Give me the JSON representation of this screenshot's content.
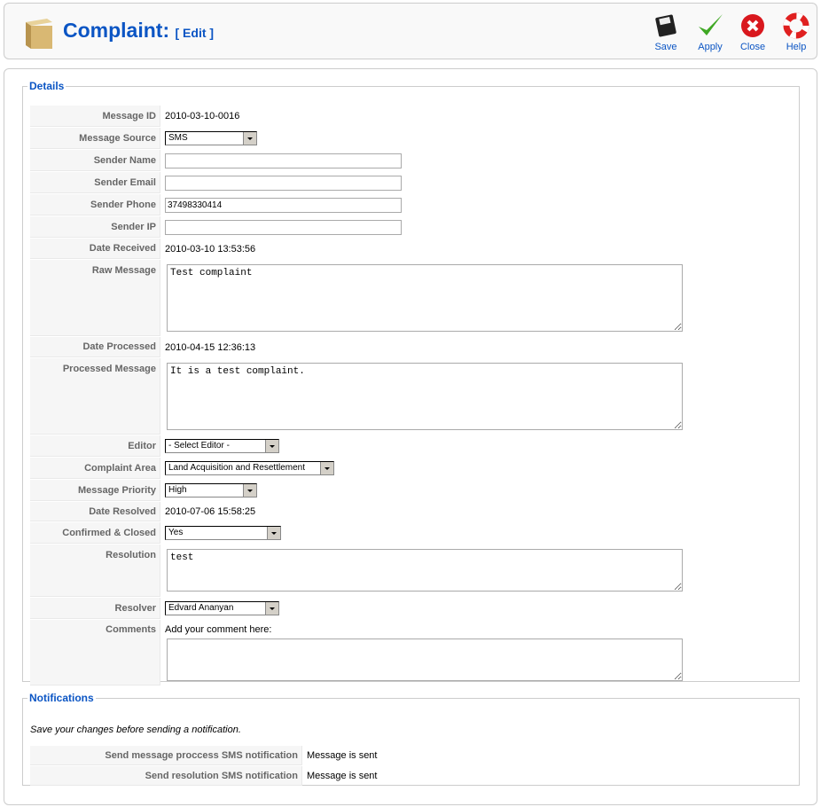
{
  "header": {
    "title": "Complaint:",
    "subtitle": "[ Edit ]",
    "icon": "package-box-icon",
    "toolbar": [
      {
        "label": "Save",
        "icon": "floppy-disk-icon"
      },
      {
        "label": "Apply",
        "icon": "checkmark-icon"
      },
      {
        "label": "Close",
        "icon": "close-circle-icon"
      },
      {
        "label": "Help",
        "icon": "lifebuoy-icon"
      }
    ]
  },
  "details": {
    "legend": "Details",
    "message_id": {
      "label": "Message ID",
      "value": "2010-03-10-0016"
    },
    "message_source": {
      "label": "Message Source",
      "value": "SMS"
    },
    "sender_name": {
      "label": "Sender Name",
      "value": ""
    },
    "sender_email": {
      "label": "Sender Email",
      "value": ""
    },
    "sender_phone": {
      "label": "Sender Phone",
      "value": "37498330414"
    },
    "sender_ip": {
      "label": "Sender IP",
      "value": ""
    },
    "date_received": {
      "label": "Date Received",
      "value": "2010-03-10 13:53:56"
    },
    "raw_message": {
      "label": "Raw Message",
      "value": "Test complaint"
    },
    "date_processed": {
      "label": "Date Processed",
      "value": "2010-04-15 12:36:13"
    },
    "processed_message": {
      "label": "Processed Message",
      "value": "It is a test complaint."
    },
    "editor": {
      "label": "Editor",
      "value": "- Select Editor -"
    },
    "complaint_area": {
      "label": "Complaint Area",
      "value": "Land Acquisition and Resettlement"
    },
    "message_priority": {
      "label": "Message Priority",
      "value": "High"
    },
    "date_resolved": {
      "label": "Date Resolved",
      "value": "2010-07-06 15:58:25"
    },
    "confirmed_closed": {
      "label": "Confirmed & Closed",
      "value": "Yes"
    },
    "resolution": {
      "label": "Resolution",
      "value": "test"
    },
    "resolver": {
      "label": "Resolver",
      "value": "Edvard Ananyan"
    },
    "comments": {
      "label": "Comments",
      "hint": "Add your comment here:",
      "value": ""
    }
  },
  "notifications": {
    "legend": "Notifications",
    "note": "Save your changes before sending a notification.",
    "rows": [
      {
        "label": "Send message proccess SMS notification",
        "value": "Message is sent"
      },
      {
        "label": "Send resolution SMS notification",
        "value": "Message is sent"
      }
    ]
  }
}
